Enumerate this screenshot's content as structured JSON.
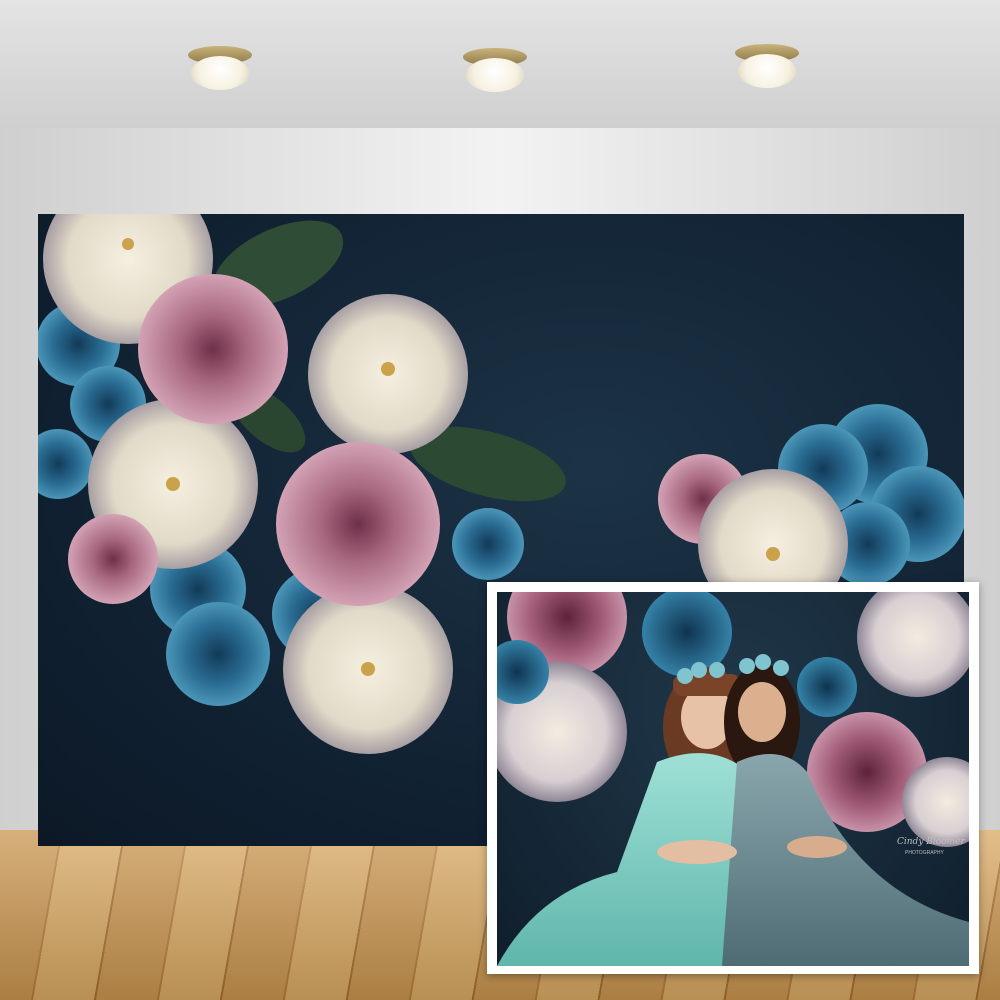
{
  "scene": {
    "ceiling_lights": [
      "light",
      "light",
      "light"
    ],
    "backdrop_color": "#132537",
    "flower_colors": {
      "cream": "#ece6d6",
      "pink": "#b97a93",
      "blue": "#2d6f94",
      "leaf": "#2f4d36"
    }
  },
  "inset": {
    "dress_left_color": "#7fd1c6",
    "dress_right_color": "#6e8d96",
    "watermark_signature": "Cindy Bloomer",
    "watermark_caption": "PHOTOGRAPHY"
  }
}
